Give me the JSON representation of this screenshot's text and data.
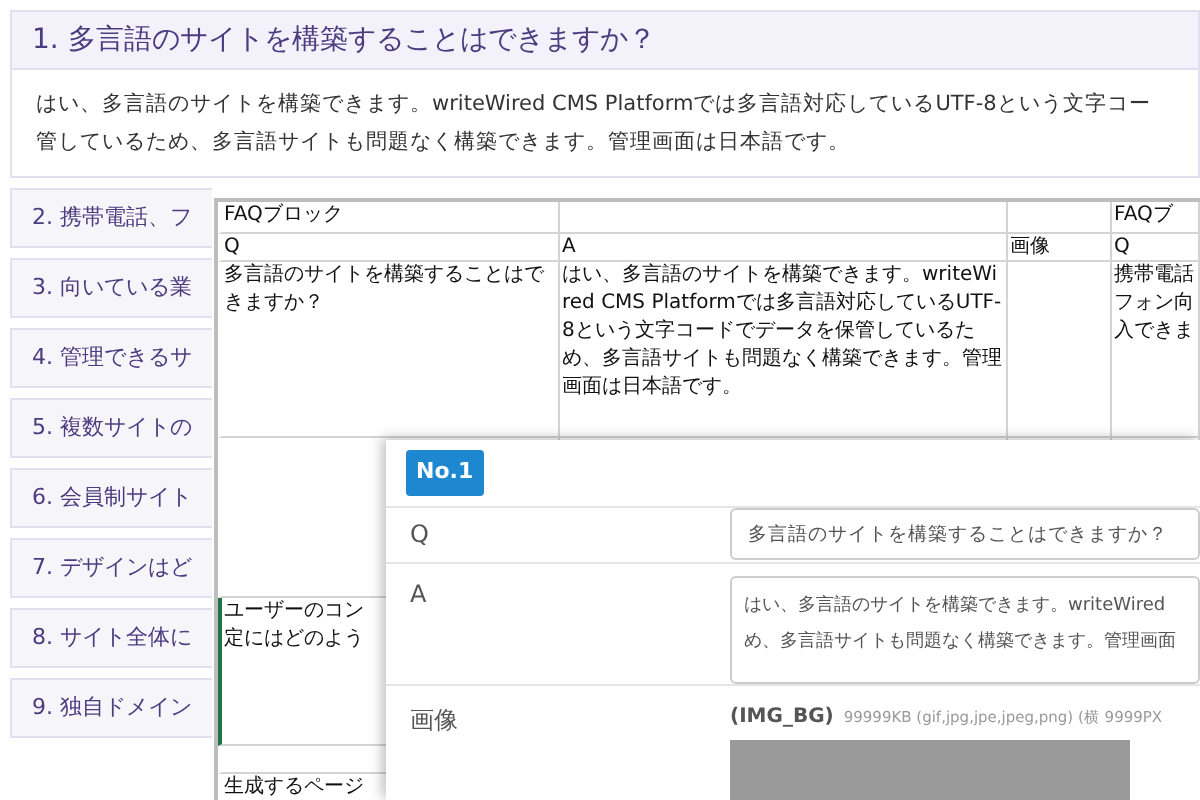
{
  "faq": {
    "items": [
      {
        "title": "1. 多言語のサイトを構築することはできますか？",
        "expanded": true,
        "body_lines": [
          "はい、多言語のサイトを構築できます。writeWired CMS Platformでは多言語対応しているUTF-8という文字コー",
          "管しているため、多言語サイトも問題なく構築できます。管理画面は日本語です。"
        ]
      },
      {
        "title": "2. 携帯電話、フ",
        "expanded": false
      },
      {
        "title": "3. 向いている業",
        "expanded": false
      },
      {
        "title": "4. 管理できるサ",
        "expanded": false
      },
      {
        "title": "5. 複数サイトの",
        "expanded": false
      },
      {
        "title": "6. 会員制サイト",
        "expanded": false
      },
      {
        "title": "7. デザインはど",
        "expanded": false
      },
      {
        "title": "8. サイト全体に",
        "expanded": false
      },
      {
        "title": "9. 独自ドメイン",
        "expanded": false
      }
    ]
  },
  "sheet": {
    "rows": [
      {
        "selected": false,
        "column_1": [
          "FAQブロック"
        ],
        "column_4": [
          "FAQブ"
        ]
      },
      {
        "selected": false,
        "column_1": [
          "Q"
        ],
        "column_2": [
          "A"
        ],
        "column_3": [
          "画像"
        ],
        "column_4": [
          "Q"
        ]
      },
      {
        "selected": false,
        "column_1": [
          "多言語のサイトを構築することはできますか？"
        ],
        "column_2": [
          "はい、多言語のサイトを構築できます。writeWired CMS Platformでは多言語対応しているUTF-8という文字コードでデータを保管しているため、多言語サイトも問題なく構築できます。管理画面は日本語です。"
        ],
        "column_4": [
          "携帯電話",
          "フォン向",
          "入できま"
        ]
      },
      {
        "selected": false
      },
      {
        "selected": true,
        "column_1": [
          "ユーザーのコン",
          "定にはどのよう"
        ]
      },
      {
        "selected": false
      },
      {
        "selected": false,
        "column_1": [
          "生成するページ"
        ]
      }
    ]
  },
  "form": {
    "badge": "No.1",
    "rows": [
      {
        "kind": "input",
        "label": "Q",
        "value": "多言語のサイトを構築することはできますか？"
      },
      {
        "kind": "textarea",
        "label": "A",
        "value": "はい、多言語のサイトを構築できます。writeWired\nめ、多言語サイトも問題なく構築できます。管理画面"
      },
      {
        "kind": "image",
        "label": "画像",
        "tag": "(IMG_BG)",
        "hint": "99999KB (gif,jpg,jpe,jpeg,png) (横 9999PX"
      }
    ]
  }
}
